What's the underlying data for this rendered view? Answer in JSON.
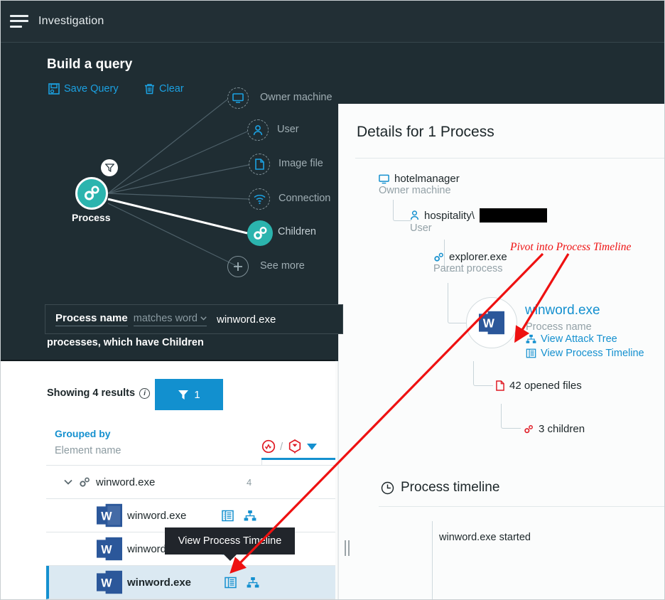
{
  "app": {
    "title": "Investigation",
    "menu_icon": "hamburger-icon"
  },
  "query_builder": {
    "heading": "Build a query",
    "save_label": "Save Query",
    "clear_label": "Clear",
    "center_node_label": "Process",
    "nodes": [
      {
        "label": "Owner machine",
        "icon": "monitor-icon",
        "state": "available"
      },
      {
        "label": "User",
        "icon": "user-icon",
        "state": "available"
      },
      {
        "label": "Image file",
        "icon": "file-icon",
        "state": "available"
      },
      {
        "label": "Connection",
        "icon": "wifi-icon",
        "state": "available"
      },
      {
        "label": "Children",
        "icon": "process-gears-icon",
        "state": "selected"
      },
      {
        "label": "See more",
        "icon": "plus-icon",
        "state": "available"
      }
    ],
    "condition": {
      "field": "Process name",
      "operator": "matches word",
      "value": "winword.exe"
    },
    "suffix_text": "processes, which have Children"
  },
  "results": {
    "showing_text": "Showing 4 results",
    "info_icon": "info-icon",
    "filter_button": {
      "icon": "funnel-icon",
      "count": "1"
    },
    "grouped_by_label": "Grouped by",
    "grouped_by_value": "Element name",
    "header_icons": [
      "risk-circle-icon",
      "alert-hexagon-icon",
      "chevron-down-icon"
    ],
    "separator": "/",
    "rows": [
      {
        "type": "group",
        "label": "winword.exe",
        "count": "4",
        "icon": "process-gears-icon",
        "expanded": true
      },
      {
        "type": "child",
        "label": "winword.exe",
        "icon": "word-icon",
        "selected": false
      },
      {
        "type": "child",
        "label": "winword.exe",
        "icon": "word-icon",
        "selected": false
      },
      {
        "type": "child",
        "label": "winword.exe",
        "icon": "word-icon",
        "selected": true
      }
    ],
    "row_actions": [
      "process-timeline-icon",
      "attack-tree-icon"
    ],
    "tooltip": "View Process Timeline"
  },
  "details": {
    "title": "Details for 1 Process",
    "tree": [
      {
        "name": "hotelmanager",
        "sub": "Owner machine",
        "icon": "monitor-icon"
      },
      {
        "name": "hospitality\\",
        "sub": "User",
        "icon": "user-icon",
        "redacted": true
      },
      {
        "name": "explorer.exe",
        "sub": "Parent process",
        "icon": "process-gears-icon"
      }
    ],
    "focus": {
      "name": "winword.exe",
      "sub": "Process name",
      "icon": "word-icon",
      "links": [
        {
          "label": "View Attack Tree",
          "icon": "attack-tree-icon"
        },
        {
          "label": "View Process Timeline",
          "icon": "process-timeline-icon"
        }
      ]
    },
    "children_nodes": [
      {
        "label": "42 opened files",
        "icon": "file-icon-red"
      },
      {
        "label": "3 children",
        "icon": "process-gears-icon-red"
      }
    ],
    "timeline": {
      "title": "Process timeline",
      "icon": "clock-icon",
      "events": [
        "winword.exe started"
      ]
    }
  },
  "annotation": {
    "text": "Pivot into Process Timeline",
    "color": "#ee1111"
  },
  "colors": {
    "dark_panel": "#1f2d33",
    "topbar": "#222f35",
    "accent_blue": "#1490cf",
    "teal_node": "#2bb4ae",
    "selected_row": "#dbe9f2",
    "annotation_red": "#ee1111"
  }
}
